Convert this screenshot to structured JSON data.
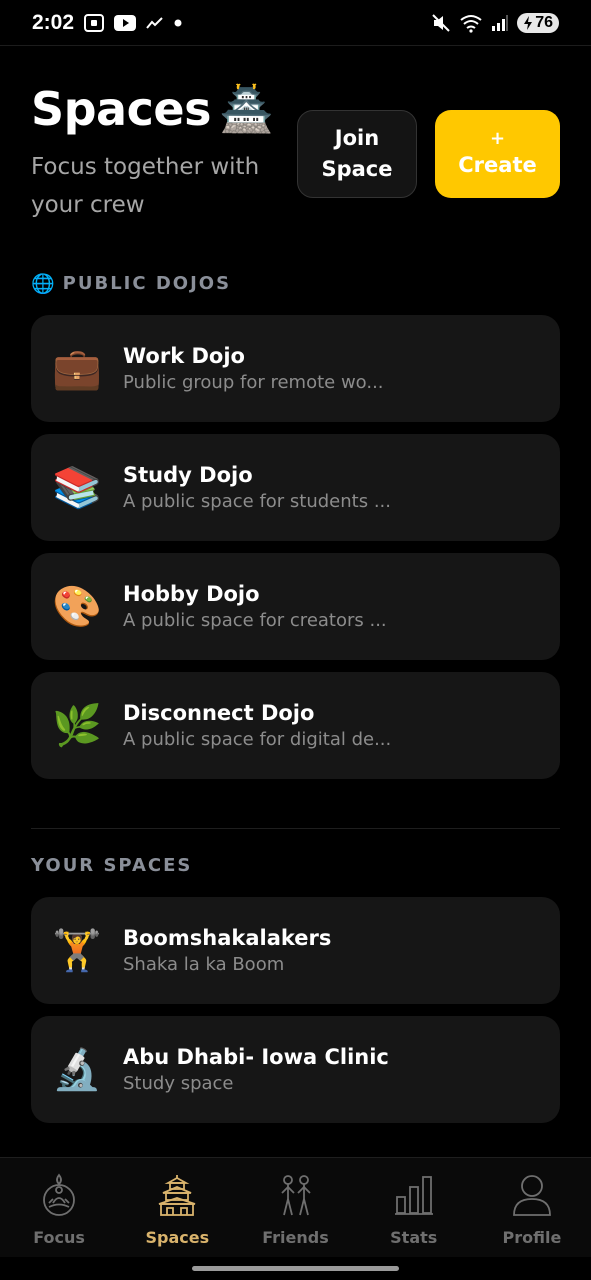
{
  "status_bar": {
    "time": "2:02",
    "battery": "76",
    "icons": [
      "screenshot-icon",
      "youtube-icon",
      "activity-icon",
      "dot-icon",
      "mute-icon",
      "wifi-icon",
      "signal-icon",
      "battery-icon"
    ]
  },
  "header": {
    "title": "Spaces",
    "title_emoji": "🏯",
    "subtitle": "Focus together with your crew",
    "join_label": "Join\nSpace",
    "create_plus": "+",
    "create_label": "Create"
  },
  "public_section": {
    "icon": "🌐",
    "title": "PUBLIC DOJOS",
    "items": [
      {
        "emoji": "💼",
        "title": "Work Dojo",
        "desc": "Public group for remote wo..."
      },
      {
        "emoji": "📚",
        "title": "Study Dojo",
        "desc": "A public space for students ..."
      },
      {
        "emoji": "🎨",
        "title": "Hobby Dojo",
        "desc": "A public space for creators ..."
      },
      {
        "emoji": "🌿",
        "title": "Disconnect Dojo",
        "desc": "A public space for digital de..."
      }
    ]
  },
  "your_section": {
    "title": "YOUR SPACES",
    "items": [
      {
        "emoji": "🏋️",
        "title": "Boomshakalakers",
        "desc": "Shaka la ka Boom"
      },
      {
        "emoji": "🔬",
        "title": "Abu Dhabi- Iowa Clinic",
        "desc": "Study space"
      }
    ]
  },
  "nav": {
    "active": "Spaces",
    "items": [
      {
        "label": "Focus",
        "icon": "meditation-icon"
      },
      {
        "label": "Spaces",
        "icon": "castle-icon"
      },
      {
        "label": "Friends",
        "icon": "friends-icon"
      },
      {
        "label": "Stats",
        "icon": "bar-chart-icon"
      },
      {
        "label": "Profile",
        "icon": "person-icon"
      }
    ]
  },
  "colors": {
    "accent": "#FFC800",
    "active_nav": "#D9B36C",
    "card_bg": "#161616",
    "background": "#000000"
  }
}
